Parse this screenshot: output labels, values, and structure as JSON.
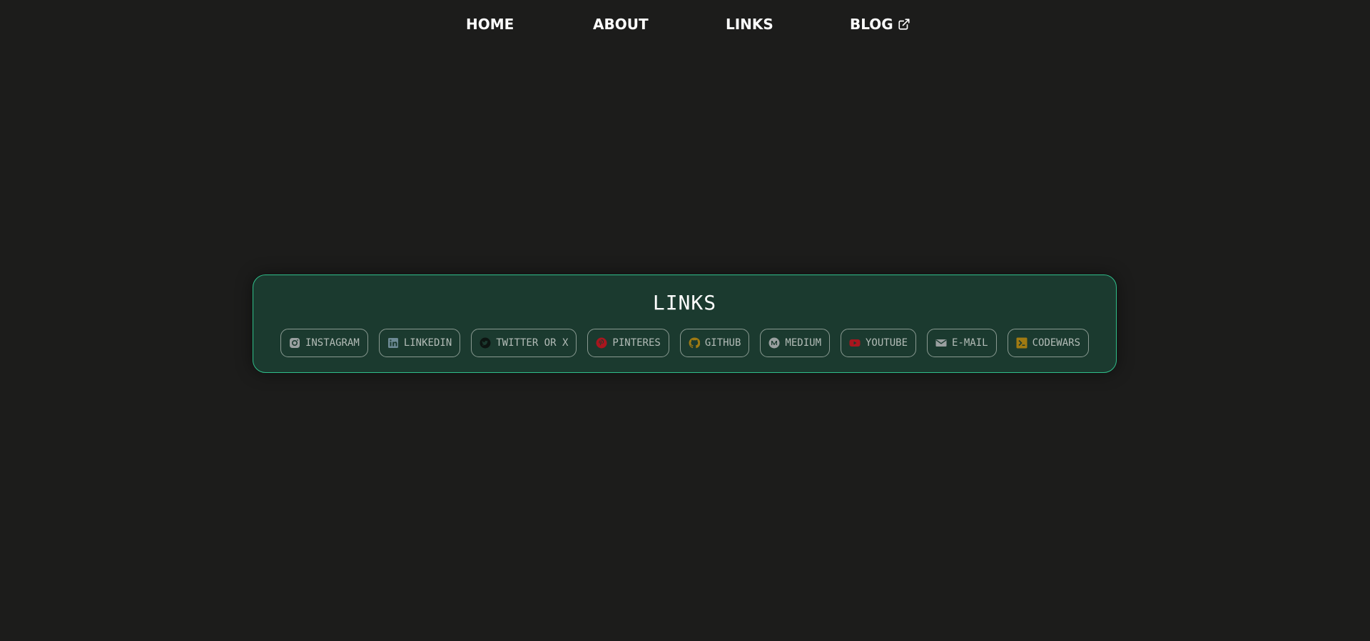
{
  "nav": {
    "home": "HOME",
    "about": "ABOUT",
    "links": "LINKS",
    "blog": "BLOG"
  },
  "links_section": {
    "title": "LINKS",
    "items": [
      {
        "label": "INSTAGRAM",
        "icon": "instagram-icon",
        "color": "#9aa0a0"
      },
      {
        "label": "LINKEDIN",
        "icon": "linkedin-icon",
        "color": "#6d8a95"
      },
      {
        "label": "TWITTER OR X",
        "icon": "twitter-icon",
        "color": "#0d1512"
      },
      {
        "label": "PINTERES",
        "icon": "pinterest-icon",
        "color": "#a8161e"
      },
      {
        "label": "GITHUB",
        "icon": "github-icon",
        "color": "#a07a12"
      },
      {
        "label": "MEDIUM",
        "icon": "medium-icon",
        "color": "#9aa0a0"
      },
      {
        "label": "YOUTUBE",
        "icon": "youtube-icon",
        "color": "#a8161e"
      },
      {
        "label": "E-MAIL",
        "icon": "email-icon",
        "color": "#9aa0a0"
      },
      {
        "label": "CODEWARS",
        "icon": "codewars-icon",
        "color": "#a07a12"
      }
    ]
  },
  "colors": {
    "background": "#1c1c1b",
    "card_background": "#1b3a2f",
    "card_border": "#2fbf8a"
  }
}
